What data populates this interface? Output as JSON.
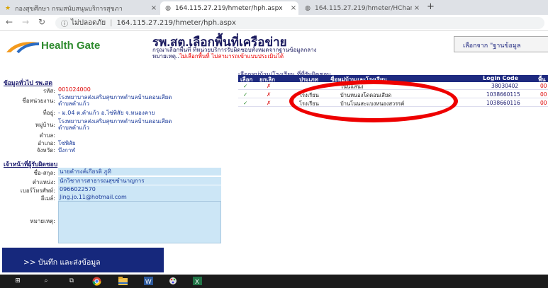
{
  "browser": {
    "tabs": [
      {
        "title": "กองสุขศึกษา กรมสนับสนุนบริการสุขภา",
        "icon": "star-icon",
        "active": false
      },
      {
        "title": "164.115.27.219/hmeter/hph.aspx",
        "icon": "globe-icon",
        "active": true
      },
      {
        "title": "164.115.27.219/hmeter/HChart/",
        "icon": "globe-icon",
        "active": false
      }
    ],
    "new_tab": "+",
    "security_label": "ไม่ปลอดภัย",
    "url": "164.115.27.219/hmeter/hph.aspx"
  },
  "header": {
    "logo_text": "Health Gate",
    "title": "รพ.สต.เลือกพื้นที่เครือข่าย",
    "subtitle1": "กรุณาเลือกพื้นที่ ที่หน่วยบริการรับผิดชอบทั้งหมดจากฐานข้อมูลกลาง",
    "subtitle2_prefix": "หมายเหตุ..",
    "subtitle2_warning": "ไม่เลือกพื้นที่ ไม่สามารถเข้าแบบประเมินได้",
    "select_button": "เลือกจาก \"ฐานข้อมูล"
  },
  "general": {
    "section_title": "ข้อมูลทั่วไป รพ.สต",
    "fields": [
      {
        "label": "รหัส:",
        "value": "001024000",
        "red": true
      },
      {
        "label": "ชื่อหน่วยงาน:",
        "value": "โรงพยาบาลส่งเสริมสุขภาพตำบลบ้านดอนเสียด",
        "value2": "ตำบลคำแก้ว"
      },
      {
        "label": "ที่อยู่:",
        "value": "- ม.04 ต.คำแก้ว อ.โซ่พิสัย จ.หนองคาย"
      },
      {
        "label": "หมู่บ้าน:",
        "value": "โรงพยาบาลส่งเสริมสุขภาพตำบลบ้านดอนเสียด",
        "value2": "ตำบลคำแก้ว"
      },
      {
        "label": "ตำบล:",
        "value": ""
      },
      {
        "label": "อำเภอ:",
        "value": "โซ่พิสัย"
      },
      {
        "label": "จังหวัด:",
        "value": "บึงกาฬ"
      }
    ]
  },
  "staff": {
    "section_title": "เจ้าหน้าที่ผู้รับผิดชอบ",
    "name_label": "ชื่อ-สกุล:",
    "name": "นายคำรงค์เกียรติ ภูทิ",
    "position_label": "ตำแหน่ง:",
    "position": "นักวิชาการสาธารณสุขชำนาญการ",
    "phone_label": "เบอร์โทรศัพท์:",
    "phone": "0966022570",
    "email_label": "อีเมล์:",
    "email": "Jing.jo.11@hotmail.com",
    "note_label": "หมายเหตุ:"
  },
  "submit_label": ">> บันทึก และส่งข้อมูล",
  "table": {
    "title": "เลือกหมู่บ้าน/โรงเรียน ที่ที่รับผิดชอบ",
    "headers": [
      "เลือก",
      "ยกเลิก",
      "ประเภท",
      "ชื่อหมู่บ้านและโรงเรียน",
      "Login Code",
      "พื้น"
    ],
    "rows": [
      {
        "type": "",
        "name": "โนนแสนง",
        "code": "38030402",
        "extra": "00"
      },
      {
        "type": "โรงเรียน",
        "name": "บ้านหนองโดดอนเสียด",
        "code": "1038660115",
        "extra": "00"
      },
      {
        "type": "โรงเรียน",
        "name": "บ้านโนนสะแบงหนองสวรรค์",
        "code": "1038660116",
        "extra": "00"
      }
    ],
    "check_glyph": "✓",
    "cross_glyph": "✗"
  },
  "taskbar": {
    "icons": [
      "windows-icon",
      "search-icon",
      "task-view-icon",
      "chrome-icon",
      "file-explorer-icon",
      "word-icon",
      "paint-icon",
      "excel-icon"
    ]
  }
}
